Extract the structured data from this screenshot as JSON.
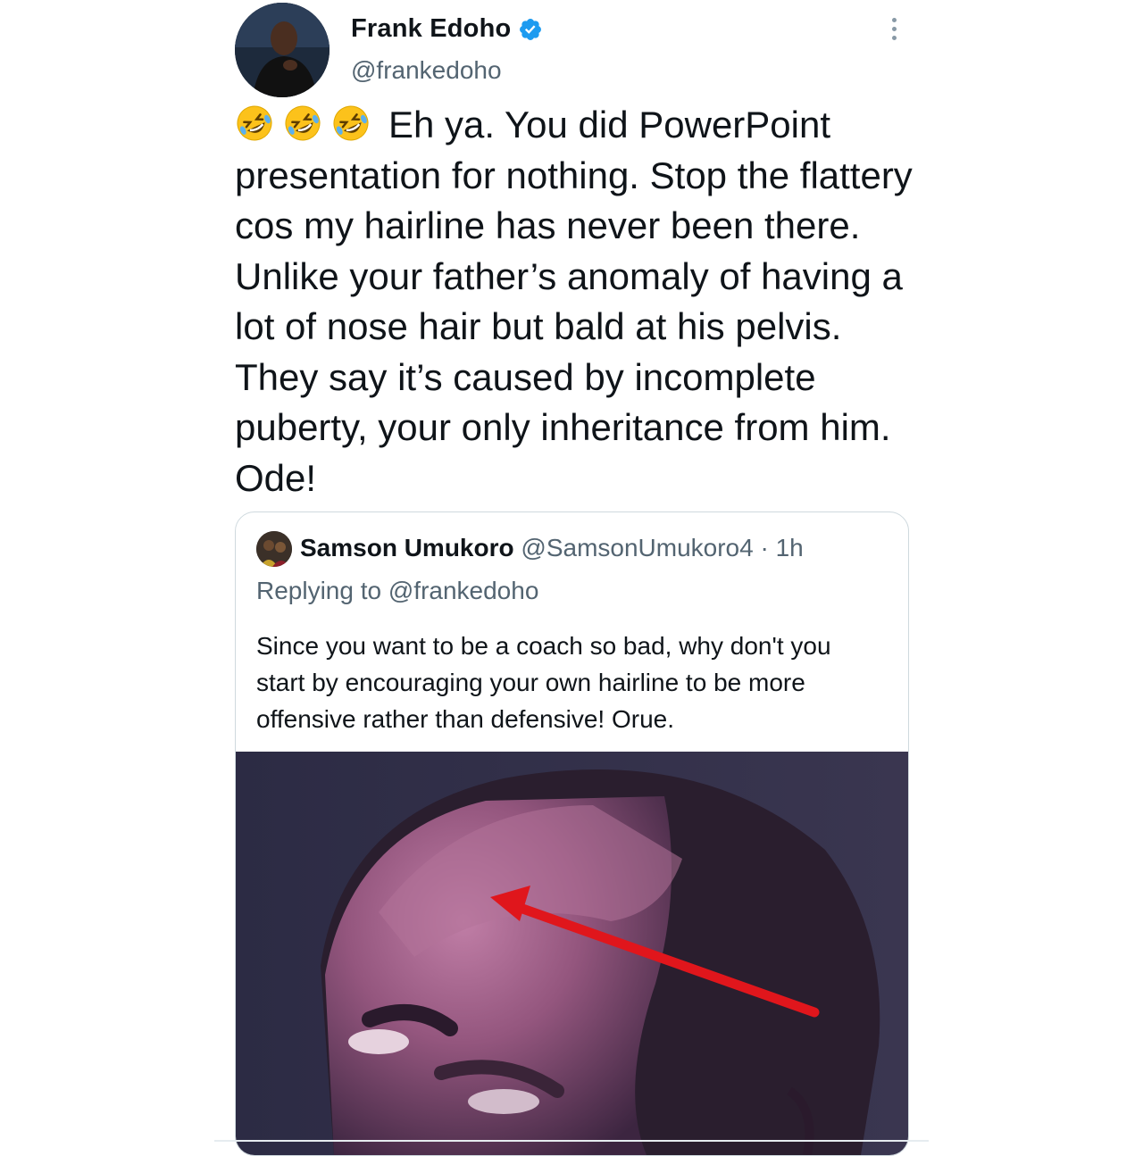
{
  "author": {
    "display_name": "Frank Edoho",
    "handle": "@frankedoho",
    "verified": true,
    "verified_color": "#1d9bf0"
  },
  "tweet": {
    "emojis": [
      "rolling-on-the-floor-laughing-emoji",
      "rolling-on-the-floor-laughing-emoji",
      "rolling-on-the-floor-laughing-emoji"
    ],
    "text": "Eh ya. You did PowerPoint presentation for nothing. Stop the flattery cos my hairline has never been there. Unlike your father’s anomaly of having a lot of nose hair but bald at his pelvis. They say it’s caused by incomplete  puberty, your only inheritance from him. Ode!"
  },
  "quoted_tweet": {
    "display_name": "Samson Umukoro",
    "handle": "@SamsonUmukoro4",
    "time": "· 1h",
    "replying_to": "Replying to @frankedoho",
    "text": "Since you want to be a coach so bad, why don't you start by encouraging your own hairline to be more offensive rather than defensive! Orue.",
    "media": {
      "kind": "photo",
      "description_icon": "photo-icon",
      "arrow_color": "#e0161c"
    }
  },
  "icons": {
    "more": "more-vertical-icon",
    "verified": "verified-badge-icon"
  }
}
